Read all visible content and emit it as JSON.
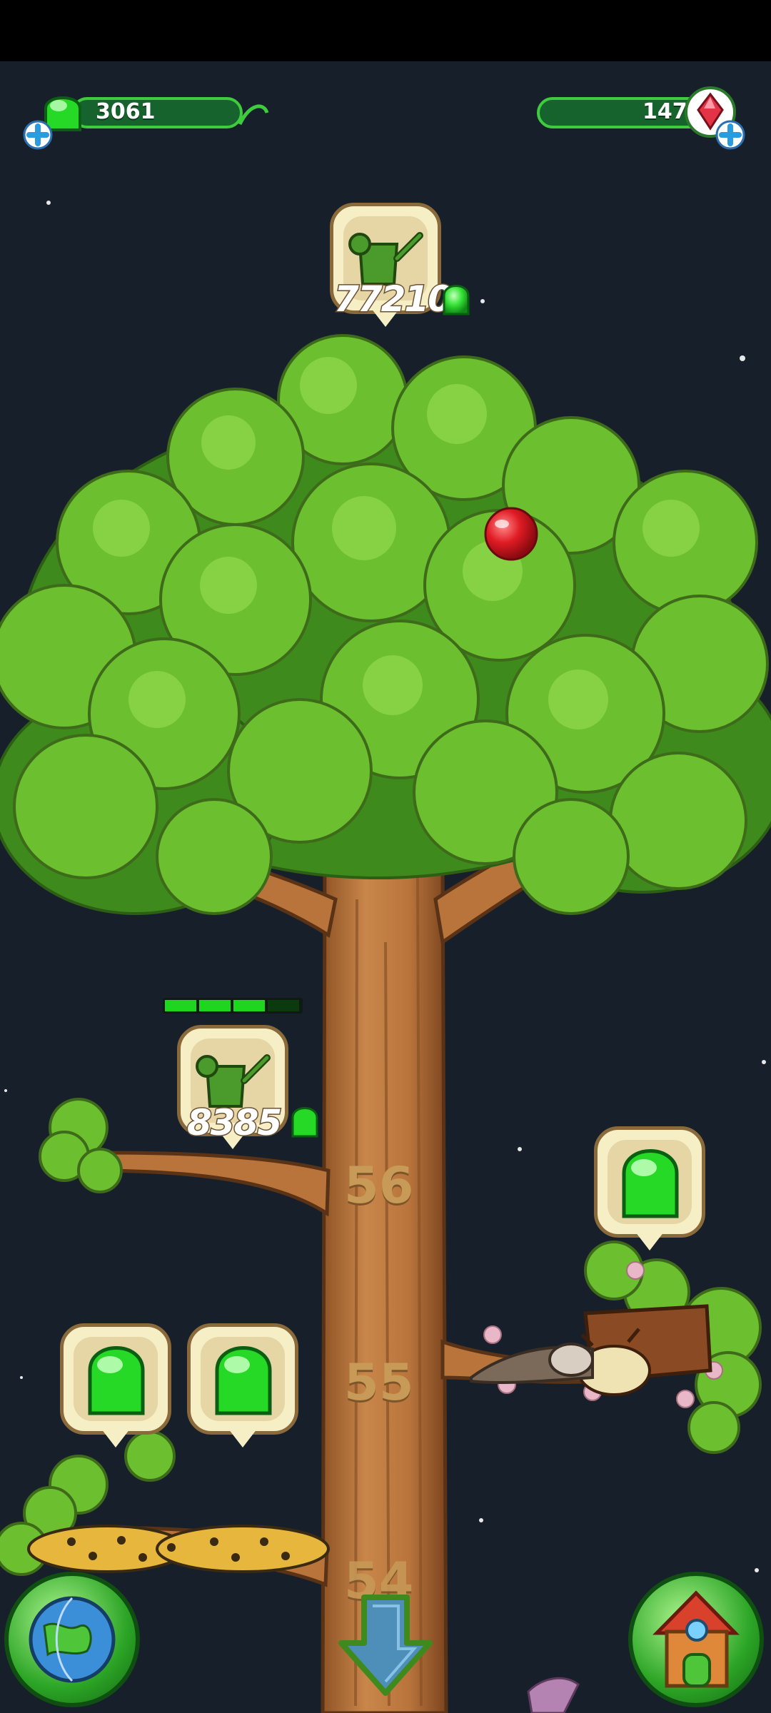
{
  "hud": {
    "left_currency": {
      "icon": "green-gem-icon",
      "value": "3061"
    },
    "right_currency": {
      "icon": "red-crystal-icon",
      "value": "147"
    }
  },
  "tree": {
    "top_upgrade": {
      "icon": "watering-can-icon",
      "cost": "77210",
      "cost_icon": "green-gem-icon"
    },
    "branch_upgrade": {
      "icon": "watering-can-icon",
      "cost": "8385",
      "cost_icon": "green-gem-icon",
      "progress_filled": 3,
      "progress_total": 4
    },
    "levels": [
      "56",
      "55",
      "54"
    ]
  },
  "nav": {
    "world_button_icon": "globe-icon",
    "down_arrow_icon": "down-arrow-icon",
    "house_button_icon": "house-icon"
  },
  "colors": {
    "background": "#17202a",
    "leaf": "#6cbf2e",
    "trunk": "#b8743b",
    "gem": "#25d926",
    "accent_green": "#3ecb3e"
  }
}
